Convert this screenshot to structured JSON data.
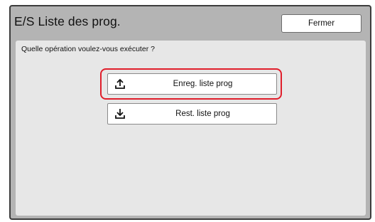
{
  "header": {
    "title": "E/S Liste des prog.",
    "close_label": "Fermer"
  },
  "main": {
    "prompt": "Quelle opération voulez-vous exécuter ?",
    "actions": [
      {
        "label": "Enreg. liste prog",
        "icon": "upload-icon",
        "selected": true
      },
      {
        "label": "Rest. liste prog",
        "icon": "download-icon",
        "selected": false
      }
    ]
  },
  "colors": {
    "frame_background": "#b4b4b4",
    "panel_background": "#e7e7e7",
    "highlight": "#e01e2b"
  }
}
